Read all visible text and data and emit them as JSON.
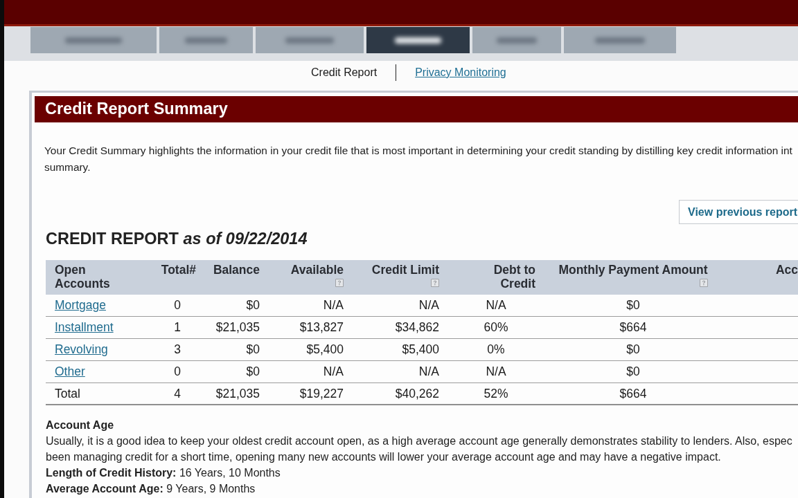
{
  "nav": {
    "tabs": [
      {
        "selected": false
      },
      {
        "selected": false
      },
      {
        "selected": false
      },
      {
        "selected": true
      },
      {
        "selected": false
      },
      {
        "selected": false
      }
    ]
  },
  "subnav": [
    {
      "label": "Credit Report",
      "selected": true
    },
    {
      "label": "Privacy Monitoring",
      "selected": false
    }
  ],
  "summary": {
    "title": "Credit Report Summary",
    "intro_lines": [
      "Your Credit Summary highlights the information in your credit file that is most important in determining your credit standing by distilling key credit information int",
      "summary."
    ],
    "button": "View previous report"
  },
  "report": {
    "heading": "CREDIT REPORT *as of 09/22/2014*",
    "columns": [
      {
        "label": "Open Accounts",
        "help": false
      },
      {
        "label": "Total#",
        "help": false
      },
      {
        "label": "Balance",
        "help": false
      },
      {
        "label": "Available",
        "help": true
      },
      {
        "label": "Credit Limit",
        "help": true
      },
      {
        "label": "Debt to Credit",
        "help": false
      },
      {
        "label": "Monthly Payment Amount",
        "help": true
      },
      {
        "label": "Acc",
        "help": false
      }
    ],
    "rows": [
      {
        "kind": "account",
        "cells": [
          "Mortgage",
          "0",
          "$0",
          "N/A",
          "N/A",
          "N/A",
          "$0"
        ]
      },
      {
        "kind": "account",
        "cells": [
          "Installment",
          "1",
          "$21,035",
          "$13,827",
          "$34,862",
          "60%",
          "$664"
        ]
      },
      {
        "kind": "account",
        "cells": [
          "Revolving",
          "3",
          "$0",
          "$5,400",
          "$5,400",
          "0%",
          "$0"
        ]
      },
      {
        "kind": "account",
        "cells": [
          "Other",
          "0",
          "$0",
          "N/A",
          "N/A",
          "N/A",
          "$0"
        ]
      },
      {
        "kind": "total",
        "cells": [
          "Total",
          "4",
          "$21,035",
          "$19,227",
          "$40,262",
          "52%",
          "$664"
        ]
      }
    ]
  },
  "account_age": {
    "title": "Account Age",
    "lines": [
      "Usually, it is a good idea to keep your oldest credit account open, as a high average account age generally demonstrates stability to lenders. Also, espec",
      "been managing credit for a short time, opening many new accounts will lower your average account age and may have a negative impact."
    ],
    "facts": [
      "**Length of Credit History:** 16 Years, 10 Months",
      "**Average Account Age:** 9 Years, 9 Months"
    ]
  }
}
